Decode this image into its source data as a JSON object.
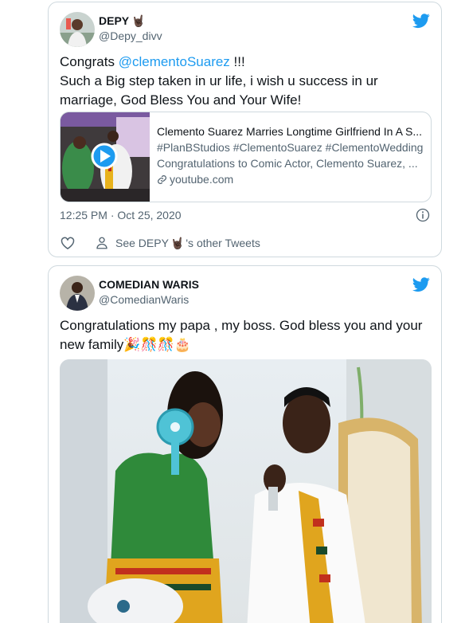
{
  "tweets": [
    {
      "display_name": "DEPY",
      "name_emoji": "🤘🏿",
      "handle": "@Depy_divv",
      "text_prefix": "Congrats ",
      "mention": "@clementoSuarez",
      "text_suffix": " !!!",
      "text_line2": "Such a Big step taken in ur life, i wish u success in ur",
      "text_line3": "marriage, God Bless You and Your Wife!",
      "card": {
        "title": "Clemento Suarez Marries Longtime Girlfriend In A S...",
        "tags": "#PlanBStudios #ClementoSuarez #ClementoWedding",
        "description": "Congratulations to Comic Actor, Clemento Suarez, ...",
        "domain": "youtube.com"
      },
      "timestamp": "12:25 PM · Oct 25, 2020",
      "see_tweets_prefix": "See DEPY",
      "see_tweets_emoji": "🤘🏿",
      "see_tweets_suffix": "'s other Tweets"
    },
    {
      "display_name": "COMEDIAN WARIS",
      "handle": "@ComedianWaris",
      "text_line1": "Congratulations my papa , my boss. God bless you and your",
      "text_line2": "new family🎉🎊🎊🎂"
    }
  ],
  "colors": {
    "twitter_blue": "#1d9bf0",
    "text_primary": "#0f1419",
    "text_secondary": "#536471",
    "border": "#cfd9de"
  },
  "icons": [
    "twitter-bird-icon",
    "info-icon",
    "heart-icon",
    "person-icon",
    "play-icon",
    "link-icon"
  ]
}
